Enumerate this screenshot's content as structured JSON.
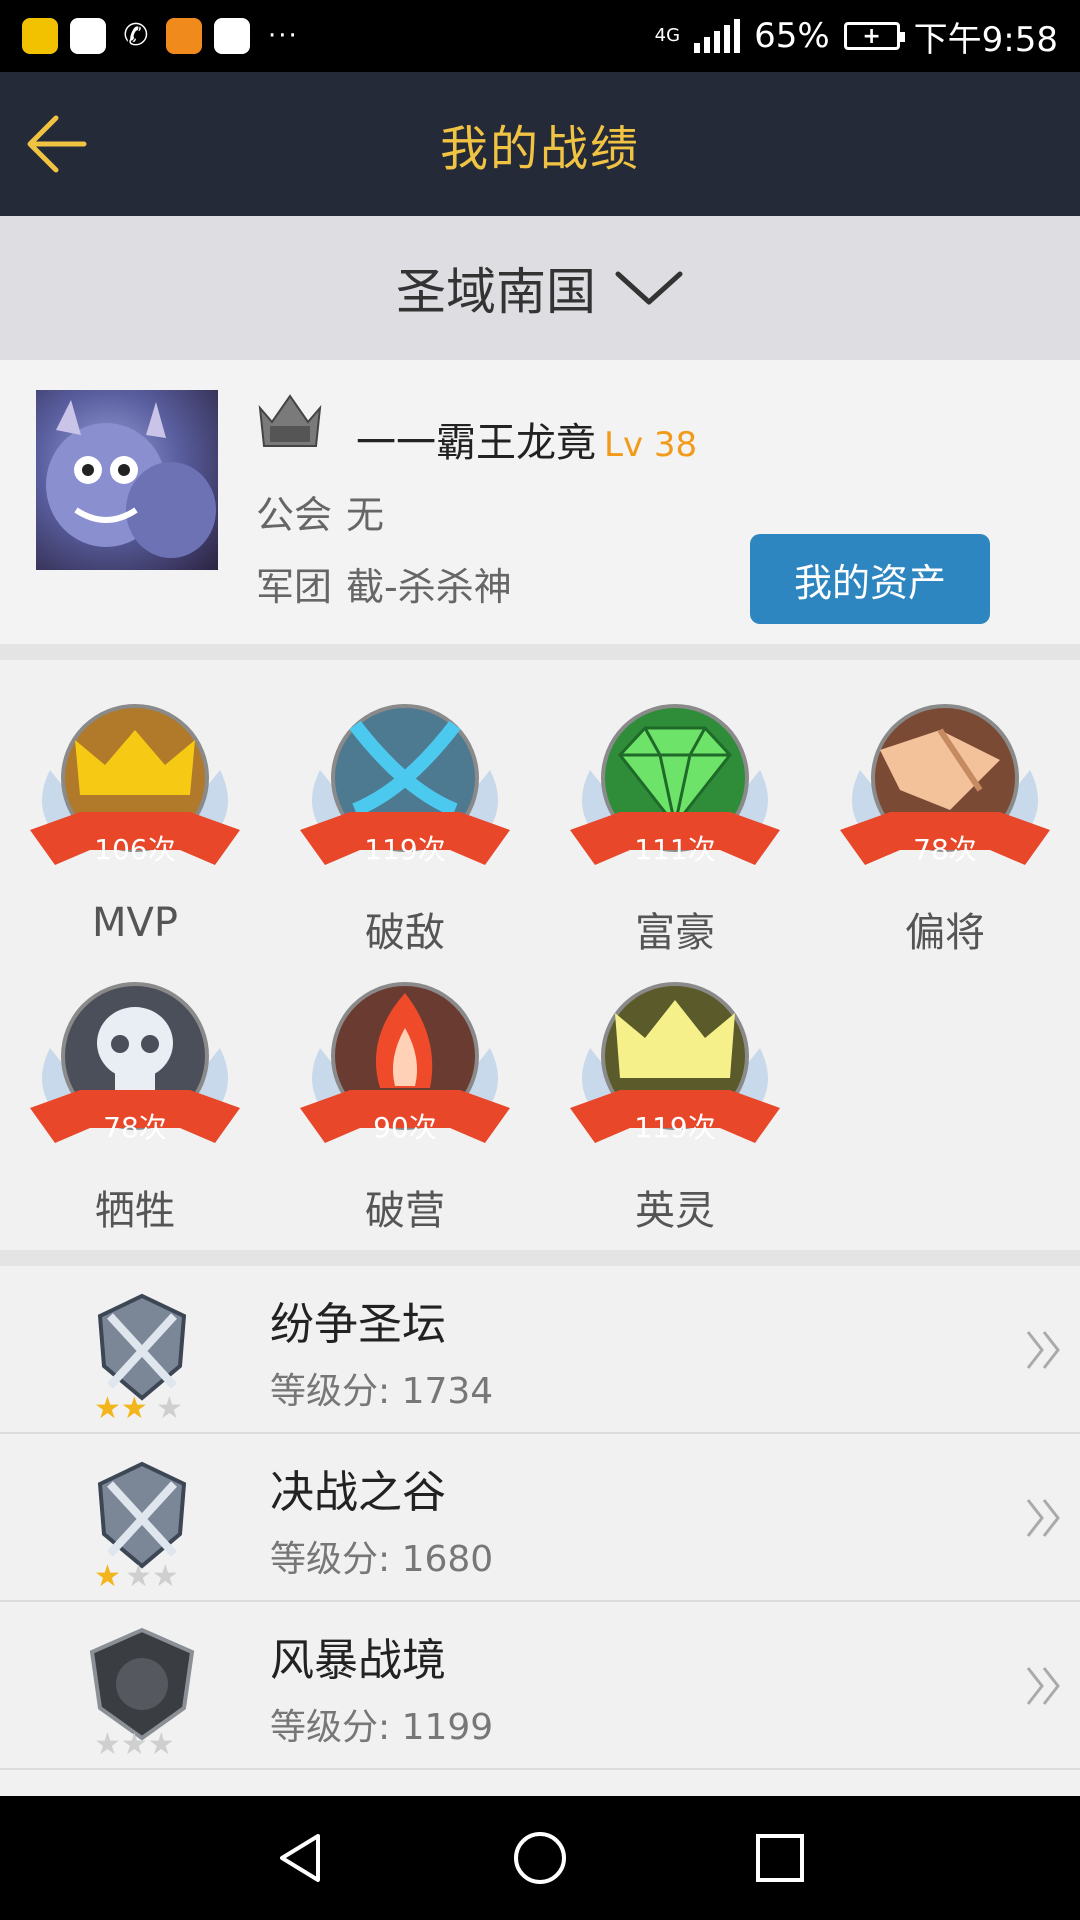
{
  "status_bar": {
    "network": "4G",
    "battery_percent": "65%",
    "time": "下午9:58",
    "more": "···"
  },
  "header": {
    "title": "我的战绩"
  },
  "server": {
    "name": "圣域南国"
  },
  "profile": {
    "name": "一一霸王龙竟",
    "level": "Lv 38",
    "guild_label": "公会",
    "guild_value": "无",
    "corps_label": "军团",
    "corps_value": "截-杀杀神",
    "assets_button": "我的资产"
  },
  "badges": [
    {
      "count": "106次",
      "label": "MVP"
    },
    {
      "count": "119次",
      "label": "破敌"
    },
    {
      "count": "111次",
      "label": "富豪"
    },
    {
      "count": "78次",
      "label": "偏将"
    },
    {
      "count": "78次",
      "label": "牺牲"
    },
    {
      "count": "90次",
      "label": "破营"
    },
    {
      "count": "119次",
      "label": "英灵"
    }
  ],
  "ranks": [
    {
      "name": "纷争圣坛",
      "score": "等级分: 1734",
      "stars": 2
    },
    {
      "name": "决战之谷",
      "score": "等级分: 1680",
      "stars": 1
    },
    {
      "name": "风暴战境",
      "score": "等级分: 1199",
      "stars": 0
    }
  ],
  "colors": {
    "header_bg": "#242a38",
    "title_gold": "#f0c343",
    "level_orange": "#f29a1a",
    "button_blue": "#2e86c1",
    "ribbon_red": "#e8472a"
  }
}
